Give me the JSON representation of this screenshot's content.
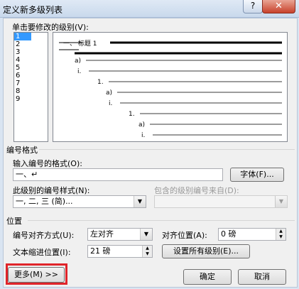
{
  "window": {
    "title": "定义新多级列表",
    "help_label": "?",
    "close_label": "✕"
  },
  "level_section": {
    "label": "单击要修改的级别(V):",
    "levels": [
      "1",
      "2",
      "3",
      "4",
      "5",
      "6",
      "7",
      "8",
      "9"
    ],
    "selected": "1"
  },
  "preview": {
    "heading_text": "一、 标题 1",
    "markers": [
      "a)",
      "i.",
      "1.",
      "a)",
      "i.",
      "1.",
      "a)",
      "i."
    ]
  },
  "number_format": {
    "group_label": "编号格式",
    "format_label": "输入编号的格式(O):",
    "format_value": "一、↵",
    "font_button": "字体(F)...",
    "style_label": "此级别的编号样式(N):",
    "style_value": "一, 二, 三 (简)...",
    "include_label": "包含的级别编号来自(D):",
    "include_value": ""
  },
  "position": {
    "group_label": "位置",
    "align_label": "编号对齐方式(U):",
    "align_value": "左对齐",
    "align_at_label": "对齐位置(A):",
    "align_at_value": "0 磅",
    "indent_label": "文本缩进位置(I):",
    "indent_value": "21 磅",
    "set_all_button": "设置所有级别(E)..."
  },
  "buttons": {
    "more": "更多(M) >>",
    "ok": "确定",
    "cancel": "取消"
  },
  "colors": {
    "highlight": "#e0242a",
    "selection": "#3399ff"
  }
}
